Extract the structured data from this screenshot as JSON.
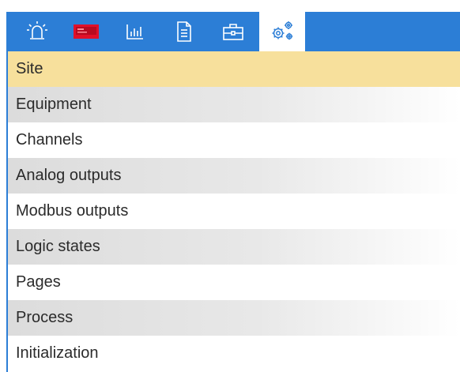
{
  "toolbar": {
    "buttons": [
      {
        "icon": "alarm-icon",
        "active": false
      },
      {
        "icon": "display-screen-icon",
        "active": false
      },
      {
        "icon": "bar-chart-icon",
        "active": false
      },
      {
        "icon": "document-icon",
        "active": false
      },
      {
        "icon": "toolbox-icon",
        "active": false
      },
      {
        "icon": "gears-icon",
        "active": true
      }
    ],
    "colors": {
      "bar": "#2c7ed6",
      "active_bg": "#ffffff",
      "icon": "#ffffff",
      "active_icon": "#2c7ed6",
      "screen_icon": "#e0102a"
    }
  },
  "menu": {
    "items": [
      {
        "label": "Site",
        "selected": true
      },
      {
        "label": "Equipment",
        "selected": false
      },
      {
        "label": "Channels",
        "selected": false
      },
      {
        "label": "Analog outputs",
        "selected": false
      },
      {
        "label": "Modbus outputs",
        "selected": false
      },
      {
        "label": "Logic states",
        "selected": false
      },
      {
        "label": "Pages",
        "selected": false
      },
      {
        "label": "Process",
        "selected": false
      },
      {
        "label": "Initialization",
        "selected": false
      }
    ],
    "colors": {
      "selected_bg": "#f7e09c",
      "shaded_bg": "#dcdcdc",
      "text": "#2b2b2b"
    }
  }
}
